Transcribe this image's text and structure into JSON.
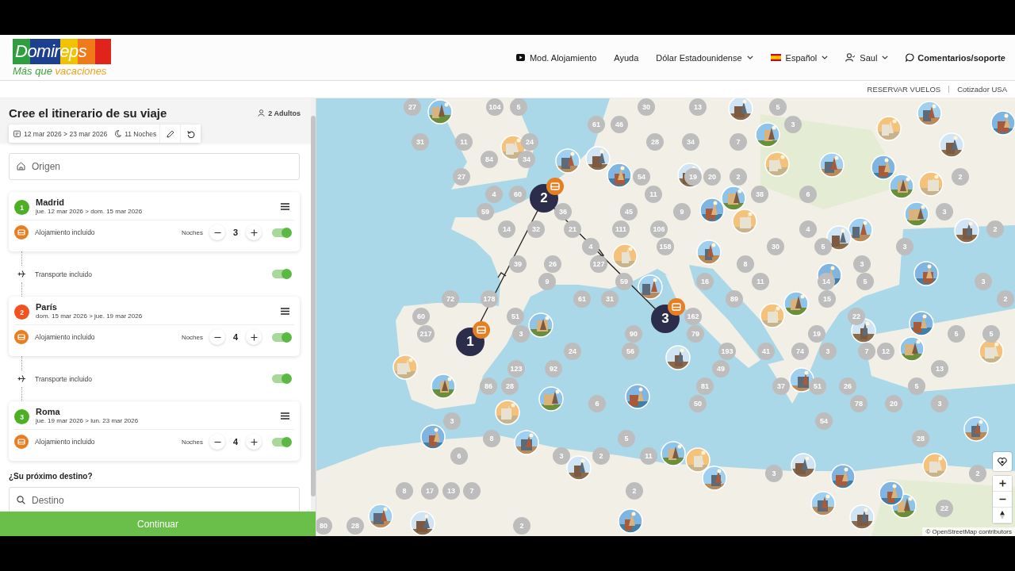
{
  "header": {
    "logo": {
      "name": "Domireps",
      "tagline": [
        "Más que",
        "vacaciones"
      ]
    },
    "nav": [
      {
        "kind": "video",
        "label": "Mod. Alojamiento",
        "dropdown": false
      },
      {
        "kind": "plain",
        "label": "Ayuda",
        "dropdown": false
      },
      {
        "kind": "plain",
        "label": "Dólar Estadounidense",
        "dropdown": true
      },
      {
        "kind": "flag",
        "label": "Español",
        "dropdown": true
      },
      {
        "kind": "user",
        "label": "Saul",
        "dropdown": true
      },
      {
        "kind": "chat",
        "label": "Comentarios/soporte",
        "dropdown": false
      }
    ],
    "sub_links": [
      "RESERVAR VUELOS",
      "Cotizador USA"
    ]
  },
  "planner": {
    "title": "Cree el itinerario de su viaje",
    "travellers": "2 Adultos",
    "dates": "12 mar 2026 > 23 mar 2026",
    "nights": "11 Noches",
    "origin": {
      "placeholder": "Origen"
    },
    "stops": [
      {
        "number": "1",
        "color": "#4caf24",
        "city": "Madrid",
        "dates": "jue. 12 mar 2026 > dom. 15 mar 2026",
        "accommodation": "Alojamiento incluido",
        "nights_label": "Noches",
        "nights": "3",
        "on": true,
        "transport": {
          "label": "Transporte incluido",
          "on": true
        }
      },
      {
        "number": "2",
        "color": "#f4511e",
        "city": "París",
        "dates": "dom. 15 mar 2026 > jue. 19 mar 2026",
        "accommodation": "Alojamiento incluido",
        "nights_label": "Noches",
        "nights": "4",
        "on": true,
        "transport": {
          "label": "Transporte incluido",
          "on": true
        }
      },
      {
        "number": "3",
        "color": "#4caf24",
        "city": "Roma",
        "dates": "jue. 19 mar 2026 > lun. 23 mar 2026",
        "accommodation": "Alojamiento incluido",
        "nights_label": "Noches",
        "nights": "4",
        "on": true
      }
    ],
    "next_label": "¿Su próximo destino?",
    "destination": {
      "placeholder": "Destino"
    },
    "continue": "Continuar"
  },
  "map": {
    "route_stops": [
      "1",
      "2",
      "3"
    ],
    "clusters": [
      "27",
      "104",
      "5",
      "30",
      "13",
      "5",
      "61",
      "46",
      "3",
      "31",
      "11",
      "24",
      "28",
      "34",
      "7",
      "84",
      "34",
      "27",
      "54",
      "19",
      "20",
      "2",
      "2",
      "4",
      "60",
      "11",
      "38",
      "6",
      "59",
      "36",
      "45",
      "9",
      "3",
      "14",
      "32",
      "21",
      "111",
      "106",
      "4",
      "2",
      "4",
      "158",
      "30",
      "5",
      "3",
      "39",
      "26",
      "127",
      "8",
      "3",
      "9",
      "59",
      "16",
      "11",
      "14",
      "5",
      "3",
      "72",
      "178",
      "61",
      "31",
      "89",
      "15",
      "2",
      "60",
      "51",
      "162",
      "22",
      "217",
      "3",
      "90",
      "79",
      "19",
      "5",
      "5",
      "24",
      "56",
      "193",
      "41",
      "74",
      "3",
      "7",
      "12",
      "123",
      "92",
      "49",
      "13",
      "86",
      "28",
      "81",
      "37",
      "51",
      "26",
      "5",
      "6",
      "50",
      "78",
      "20",
      "3",
      "3",
      "54",
      "8",
      "5",
      "28",
      "6",
      "3",
      "2",
      "11",
      "3",
      "2",
      "8",
      "17",
      "13",
      "7",
      "2",
      "22",
      "80",
      "28",
      "2"
    ],
    "attribution": "© OpenStreetMap contributors"
  }
}
